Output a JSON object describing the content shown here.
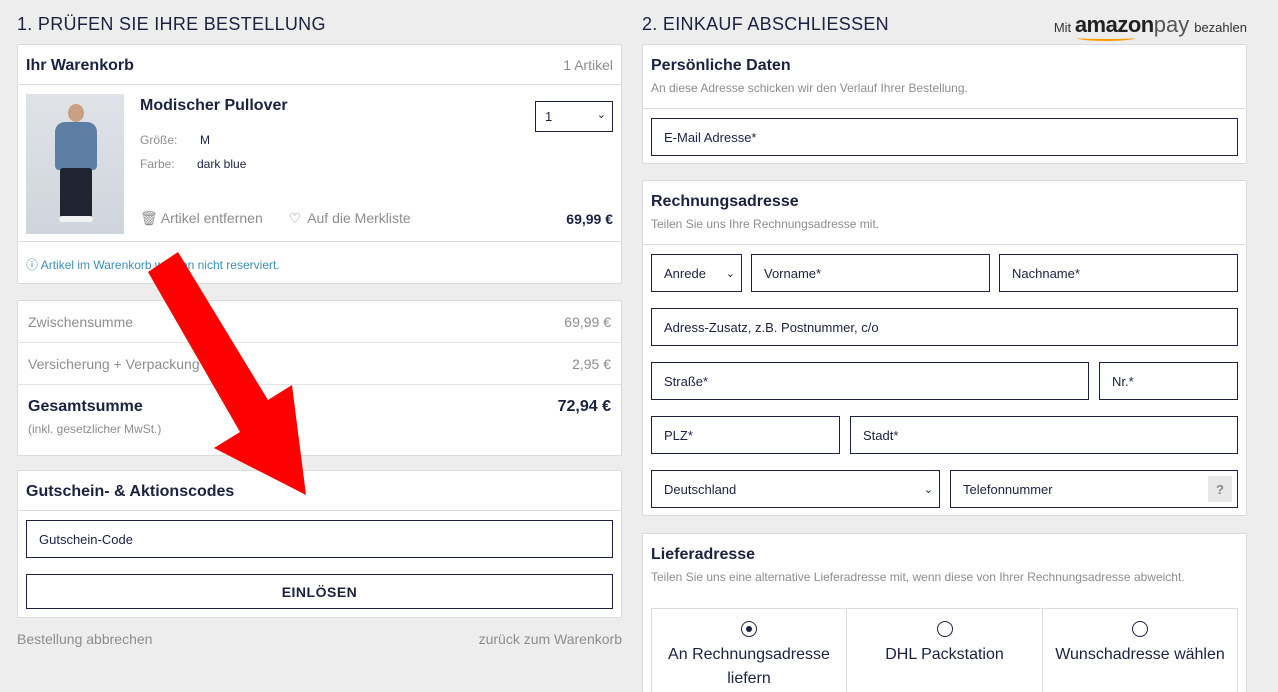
{
  "left": {
    "heading": "1. PRÜFEN SIE IHRE BESTELLUNG",
    "cart": {
      "title": "Ihr Warenkorb",
      "count": "1 Artikel",
      "product": {
        "name": "Modischer Pullover",
        "size_label": "Größe:",
        "size_value": "M",
        "color_label": "Farbe:",
        "color_value": "dark blue",
        "quantity": "1",
        "remove_label": "Artikel entfernen",
        "wishlist_label": "Auf die Merkliste",
        "price": "69,99 €"
      },
      "notice": "Artikel im Warenkorb werden nicht reserviert."
    },
    "totals": {
      "subtotal_label": "Zwischensumme",
      "subtotal_value": "69,99 €",
      "shipping_label": "Versicherung + Verpackung",
      "shipping_value": "2,95 €",
      "total_label": "Gesamtsumme",
      "total_value": "72,94 €",
      "total_note": "(inkl. gesetzlicher MwSt.)"
    },
    "voucher": {
      "title": "Gutschein- & Aktionscodes",
      "placeholder": "Gutschein-Code",
      "redeem_label": "EINLÖSEN"
    },
    "cancel_link": "Bestellung abbrechen",
    "back_link": "zurück zum Warenkorb"
  },
  "right": {
    "heading": "2. EINKAUF ABSCHLIESSEN",
    "amazon": {
      "prefix": "Mit",
      "brand": "amazon",
      "pay": "pay",
      "suffix": "bezahlen"
    },
    "personal": {
      "title": "Persönliche Daten",
      "desc": "An diese Adresse schicken wir den Verlauf Ihrer Bestellung.",
      "email_placeholder": "E-Mail Adresse*"
    },
    "billing": {
      "title": "Rechnungsadresse",
      "desc": "Teilen Sie uns Ihre Rechnungsadresse mit.",
      "salutation": "Anrede",
      "firstname": "Vorname*",
      "lastname": "Nachname*",
      "address_extra": "Adress-Zusatz, z.B. Postnummer, c/o",
      "street": "Straße*",
      "number": "Nr.*",
      "zip": "PLZ*",
      "city": "Stadt*",
      "country": "Deutschland",
      "phone": "Telefonnummer",
      "help": "?"
    },
    "delivery": {
      "title": "Lieferadresse",
      "desc": "Teilen Sie uns eine alternative Lieferadresse mit, wenn diese von Ihrer Rechnungsadresse abweicht.",
      "options": [
        "An Rechnungsadresse liefern",
        "DHL Packstation",
        "Wunschadresse wählen"
      ],
      "selected_index": 0
    }
  },
  "colors": {
    "accent": "#1b2240",
    "info": "#3c8fb8",
    "arrow": "#ff0000",
    "amazon_smile": "#ff9900"
  }
}
